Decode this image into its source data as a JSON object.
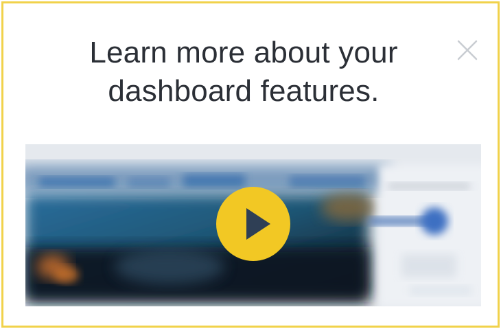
{
  "modal": {
    "title_line1": "Learn more about your",
    "title_line2": "dashboard features."
  },
  "icons": {
    "close": "close-icon",
    "play": "play-icon"
  },
  "colors": {
    "border": "#f1d24b",
    "play_button": "#f2c824",
    "title_text": "#2b2f36",
    "close_icon": "#c9cdd2"
  }
}
